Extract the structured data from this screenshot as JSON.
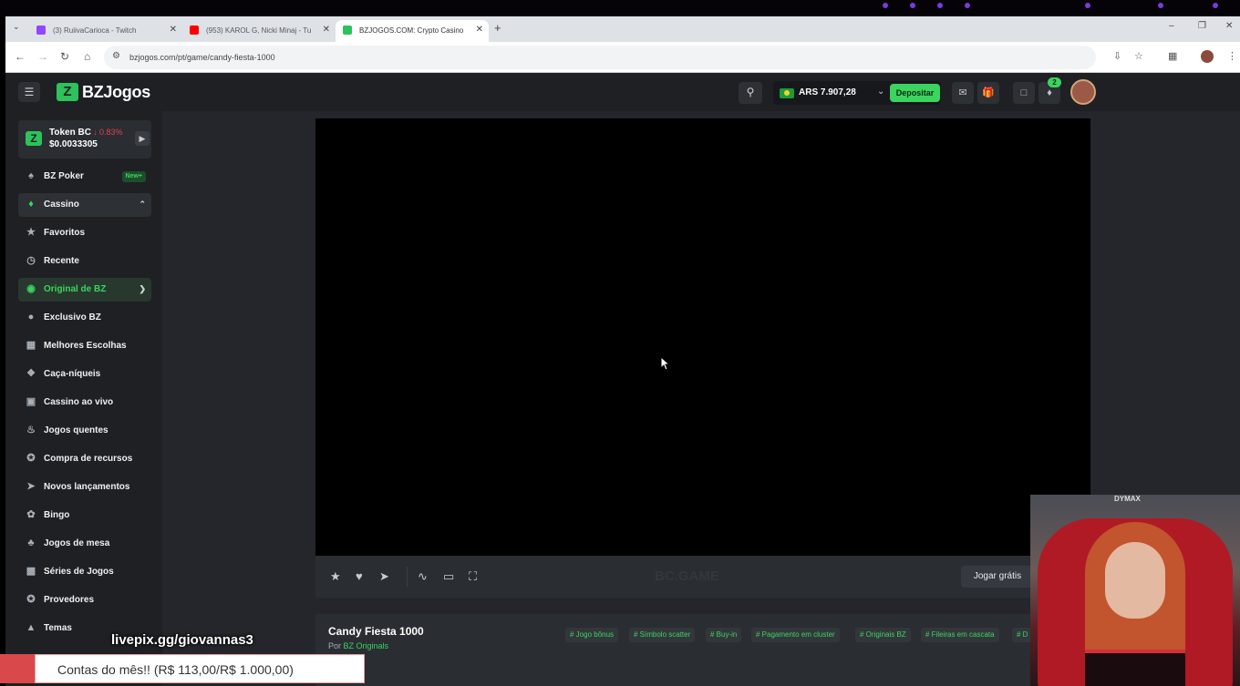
{
  "browser": {
    "tabs": [
      {
        "label": "(3) RuiivaCarioca - Twitch",
        "favicon_color": "#9146ff"
      },
      {
        "label": "(953) KAROL G, Nicki Minaj - Tu",
        "favicon_color": "#ff0000"
      },
      {
        "label": "BZJOGOS.COM: Crypto Casino",
        "favicon_color": "#2ec25a"
      }
    ],
    "url": "bzjogos.com/pt/game/candy-fiesta-1000"
  },
  "header": {
    "brand": "BZJogos",
    "balance": "ARS 7.907,28",
    "deposit_label": "Depositar",
    "notification_count": "2",
    "accent_color": "#3bd45f"
  },
  "sidebar": {
    "token": {
      "name": "Token BC",
      "change": "↓ 0.83%",
      "price": "$0.0033305"
    },
    "items": [
      {
        "label": "BZ Poker",
        "icon": "poker-icon",
        "badge": "New+"
      },
      {
        "label": "Cassino",
        "icon": "casino-icon"
      },
      {
        "label": "Favoritos",
        "icon": "star-icon"
      },
      {
        "label": "Recente",
        "icon": "clock-icon"
      },
      {
        "label": "Original de BZ",
        "icon": "bz-original-icon"
      },
      {
        "label": "Exclusivo BZ",
        "icon": "gamepad-icon"
      },
      {
        "label": "Melhores Escolhas",
        "icon": "grid-icon"
      },
      {
        "label": "Caça-níqueis",
        "icon": "slot-icon"
      },
      {
        "label": "Cassino ao vivo",
        "icon": "live-icon"
      },
      {
        "label": "Jogos quentes",
        "icon": "fire-icon"
      },
      {
        "label": "Compra de recursos",
        "icon": "feature-icon"
      },
      {
        "label": "Novos lançamentos",
        "icon": "rocket-icon"
      },
      {
        "label": "Bingo",
        "icon": "bingo-icon"
      },
      {
        "label": "Jogos de mesa",
        "icon": "table-games-icon"
      },
      {
        "label": "Séries de Jogos",
        "icon": "series-icon"
      },
      {
        "label": "Provedores",
        "icon": "providers-icon"
      },
      {
        "label": "Temas",
        "icon": "themes-icon"
      }
    ]
  },
  "game": {
    "title": "Candy Fiesta 1000",
    "by_prefix": "Por",
    "provider": "BZ Originals",
    "play_free_label": "Jogar grátis",
    "watermark": "BC.GAME",
    "tags": [
      "# Jogo bônus",
      "# Símbolo scatter",
      "# Buy-in",
      "# Pagamento em cluster",
      "# Originais BZ",
      "# Fileiras em cascata",
      "# D"
    ]
  },
  "overlay": {
    "livepix": "livepix.gg/giovannas3",
    "contas": "Contas do mês!! (R$ 113,00/R$ 1.000,00)",
    "webcam_brand": "DYMAX"
  }
}
